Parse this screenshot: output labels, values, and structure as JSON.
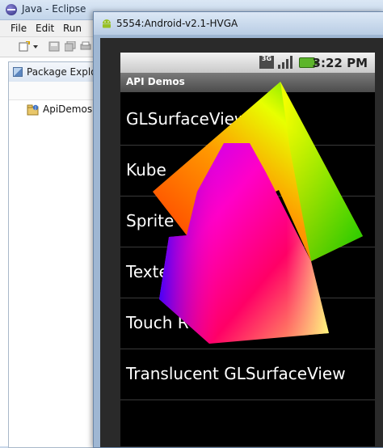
{
  "eclipse": {
    "title": "Java - Eclipse",
    "menu": [
      "File",
      "Edit",
      "Run"
    ],
    "toolbar_icons": [
      "new-wizard-icon",
      "dropdown-arrow-icon",
      "save-icon",
      "save-all-icon",
      "print-icon"
    ],
    "package_explorer": {
      "title": "Package Explore",
      "items": [
        {
          "label": "ApiDemos",
          "icon": "java-project-icon"
        }
      ]
    }
  },
  "emulator": {
    "title": "5554:Android-v2.1-HVGA",
    "icon": "android-icon",
    "status_bar": {
      "network": "3G",
      "time": "3:22 PM"
    },
    "app_title": "API Demos",
    "list_items": [
      {
        "label": "GLSurfaceView"
      },
      {
        "label": "Kube"
      },
      {
        "label": "Sprite"
      },
      {
        "label": "Texte"
      },
      {
        "label": "Touch R"
      },
      {
        "label": "Translucent GLSurfaceView"
      }
    ]
  },
  "colors": {
    "android_background": "#000000",
    "list_text": "#ffffff",
    "titlebar_blue": "#c3d5ea"
  }
}
